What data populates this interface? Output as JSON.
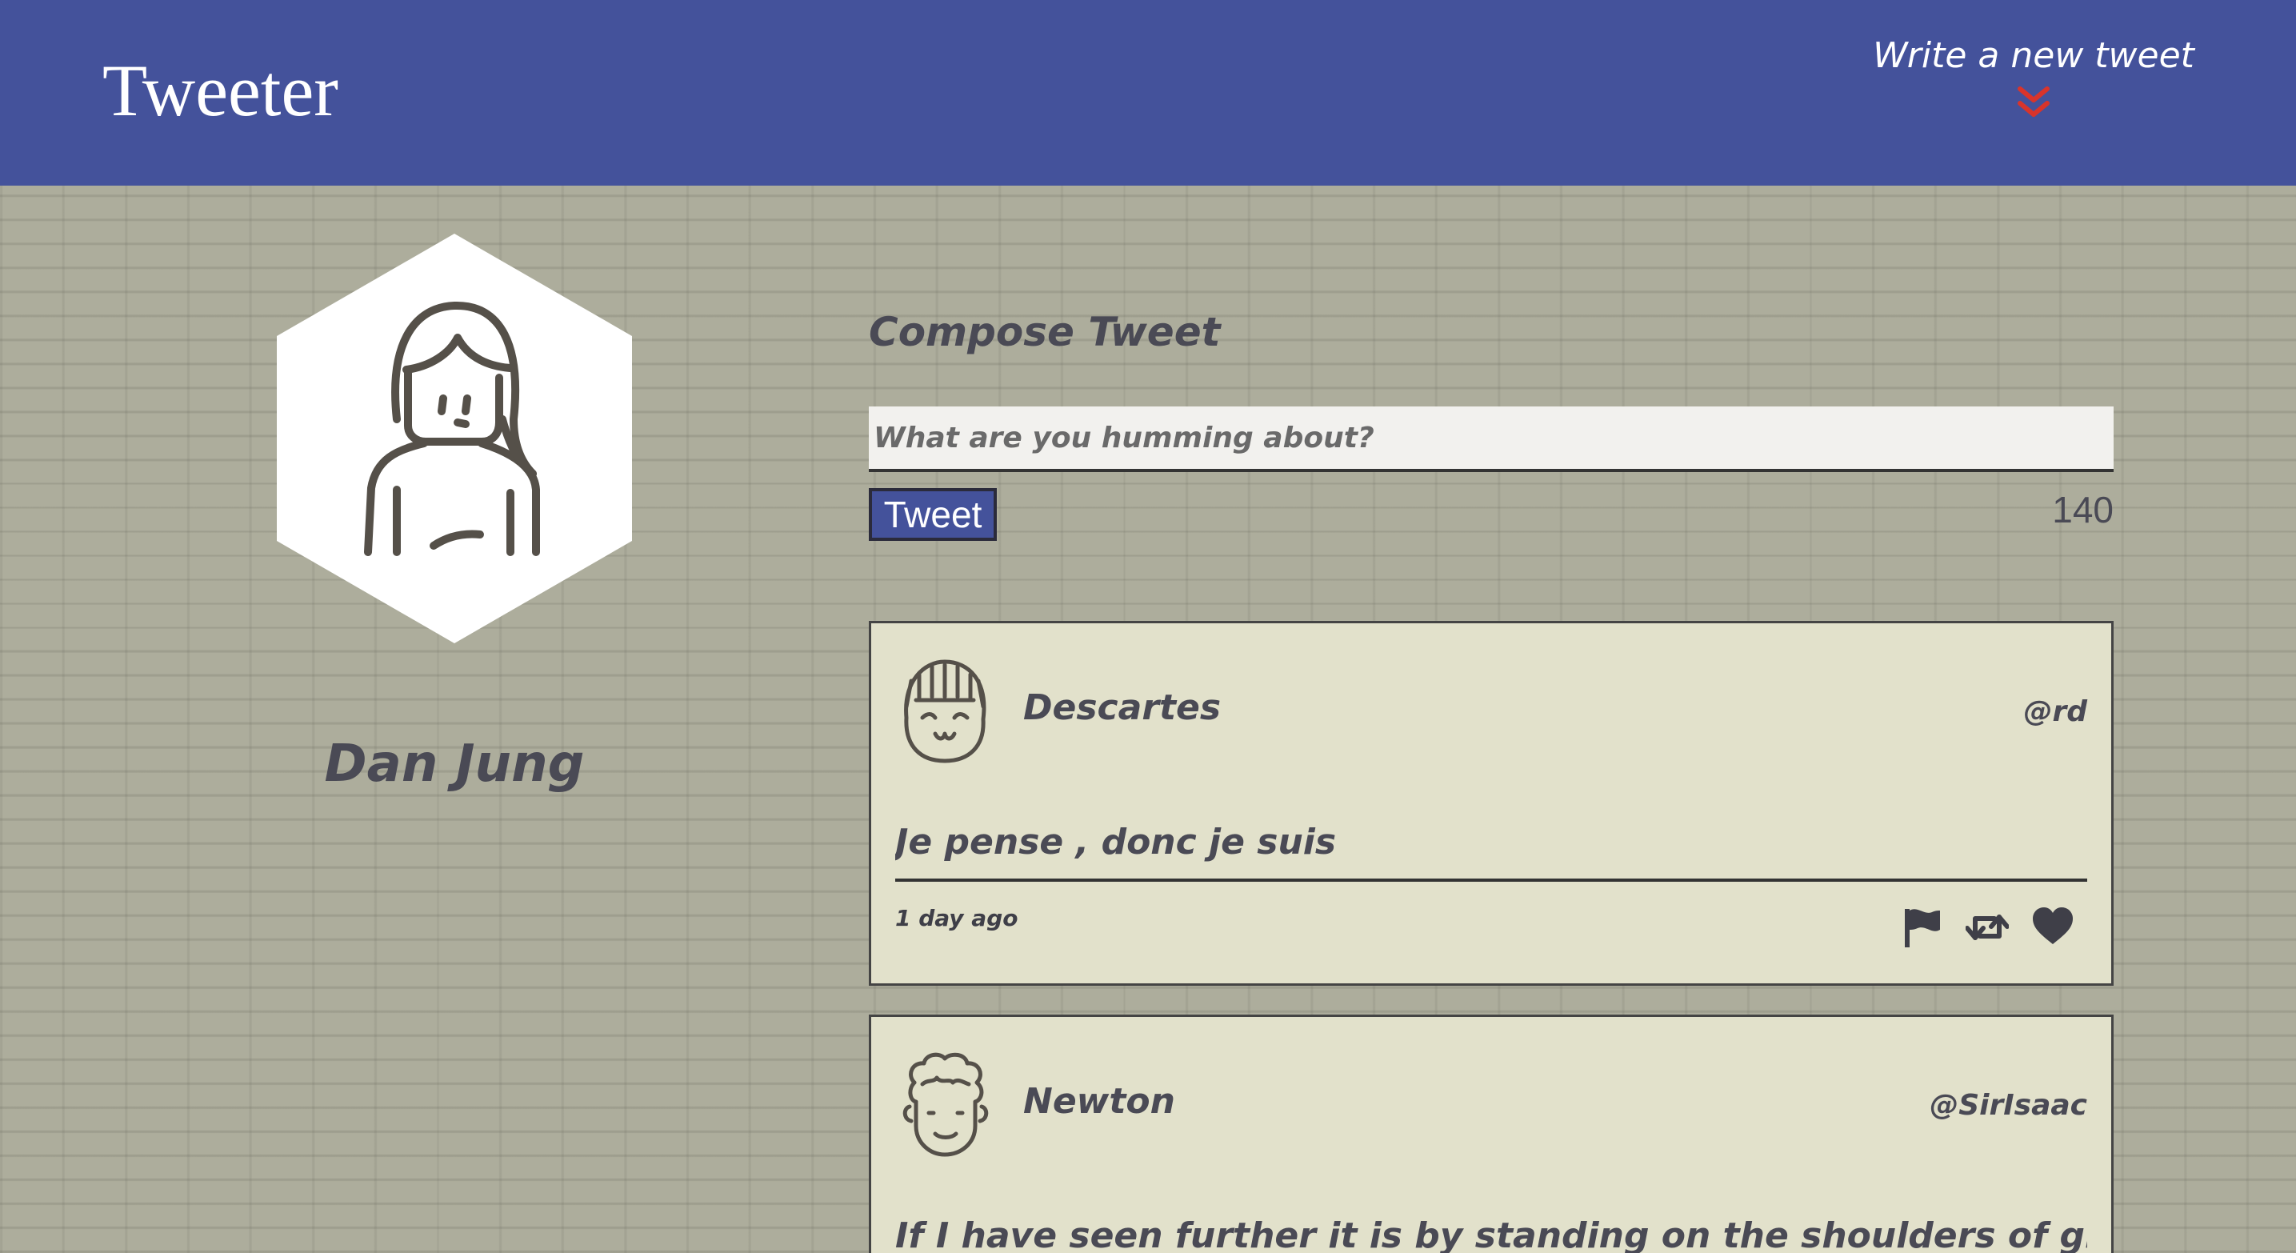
{
  "nav": {
    "brand": "Tweeter",
    "compose_toggle_label": "Write a new tweet",
    "compose_toggle_icon": "chevron-double-down-icon",
    "bg_color": "#44529b",
    "accent_color": "#d9342b"
  },
  "profile": {
    "name": "Dan Jung",
    "avatar_icon": "woman-avatar-icon"
  },
  "compose": {
    "title": "Compose Tweet",
    "placeholder": "What are you humming about?",
    "value": "",
    "button_label": "Tweet",
    "counter": "140"
  },
  "tweets": [
    {
      "author": "Descartes",
      "handle": "@rd",
      "text": "Je pense , donc je suis",
      "time": "1 day ago",
      "avatar_icon": "smiling-girl-avatar-icon",
      "actions": [
        "flag-icon",
        "retweet-icon",
        "heart-icon"
      ]
    },
    {
      "author": "Newton",
      "handle": "@SirIsaac",
      "text": "If I have seen further it is by standing on the shoulders of giants",
      "avatar_icon": "curly-hair-man-avatar-icon"
    }
  ]
}
